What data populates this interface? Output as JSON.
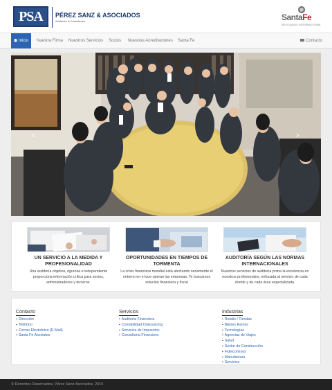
{
  "header": {
    "logo_text": "PSA",
    "firm_name": "PÉREZ SANZ & ASOCIADOS",
    "firm_tagline": "Auditores & Consultores",
    "partner_name_a": "Santa",
    "partner_name_b": "Fe",
    "partner_tagline": "ASOCIADOS INTERNACIONAL"
  },
  "nav": {
    "items": [
      {
        "label": "Inicio",
        "active": true
      },
      {
        "label": "Nuestra Firma"
      },
      {
        "label": "Nuestros Servicios"
      },
      {
        "label": "Socios"
      },
      {
        "label": "Nuestras Acreditaciones"
      },
      {
        "label": "Santa Fe"
      }
    ],
    "contact_label": "Contacto"
  },
  "hero": {
    "icons": {
      "prev": "chevron-left-icon",
      "next": "chevron-right-icon"
    }
  },
  "services": [
    {
      "title": "UN SERVICIO A LA MEDIDA Y PROFESIONALIDAD",
      "text": "Una auditoría objetiva, rigurosa e independiente proporciona información crítica para socios, administradores y terceros."
    },
    {
      "title": "OPORTUNIDADES EN TIEMPOS DE TORMENTA",
      "text": "La crisis financiera mundial está afectando seriamente el entorno en el que operan las empresas. Te buscamos solución financiera y fiscal"
    },
    {
      "title": "AUDITORÍA SEGÚN LAS NORMAS INTERNACIONALES",
      "text": "Nuestros servicios de auditoría prima la excelencia en nuestros profesionales, enfocada al servicio de cada cliente y de cada área especializada."
    }
  ],
  "footer": {
    "contacto": {
      "title": "Contacto",
      "links": [
        "Dirección",
        "Teléfono",
        "Correo Electrónico (E-Mail)",
        "Santa Fe Asociates"
      ]
    },
    "servicios": {
      "title": "Servicios",
      "links": [
        "Auditoría Financiera",
        "Contabilidad Outsourcing",
        "Servicios de Impuestos",
        "Consultoría Financiera"
      ]
    },
    "industrias": {
      "title": "Industrias",
      "links": [
        "Retails / Tiendas",
        "Bienes Raíces",
        "Tecnologías",
        "Agencias de Viajes",
        "Salud",
        "Sector de Construcción",
        "Fideicomisos",
        "Manufactura",
        "Servicios"
      ]
    },
    "copyright": "© Derechos Reservados, Pérez Sanz Asociados, 2015"
  },
  "colors": {
    "brand": "#1c3b6e",
    "accent": "#2b64b5",
    "partner_red": "#c1272d"
  }
}
